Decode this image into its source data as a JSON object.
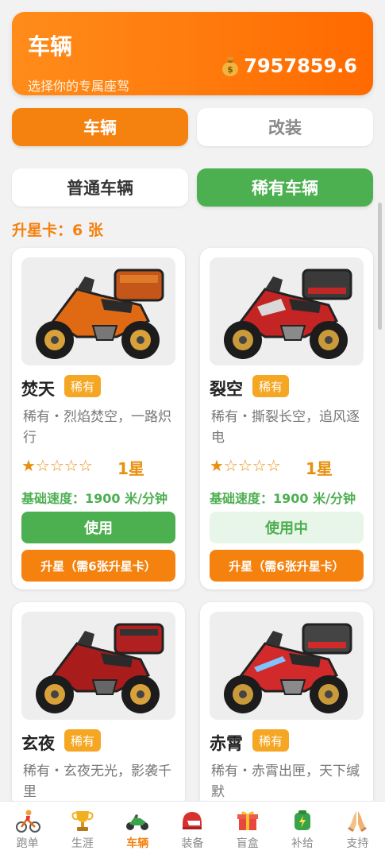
{
  "header": {
    "title": "车辆",
    "subtitle": "选择你的专属座驾",
    "coins": "7957859.6"
  },
  "tabs": {
    "vehicles": "车辆",
    "modify": "改装"
  },
  "subtabs": {
    "normal": "普通车辆",
    "rare": "稀有车辆"
  },
  "star_cards": "升星卡：6 张",
  "vehicles": [
    {
      "name": "焚天",
      "badge": "稀有",
      "desc": "稀有・烈焰焚空，一路炽行",
      "stars": "★☆☆☆☆",
      "level": "1星",
      "speed": "基础速度：1900 米/分钟",
      "use_label": "使用",
      "upgrade_label": "升星（需6张升星卡）"
    },
    {
      "name": "裂空",
      "badge": "稀有",
      "desc": "稀有・撕裂长空，追风逐电",
      "stars": "★☆☆☆☆",
      "level": "1星",
      "speed": "基础速度：1900 米/分钟",
      "use_label": "使用中",
      "upgrade_label": "升星（需6张升星卡）"
    },
    {
      "name": "玄夜",
      "badge": "稀有",
      "desc": "稀有・玄夜无光，影袭千里"
    },
    {
      "name": "赤霄",
      "badge": "稀有",
      "desc": "稀有・赤霄出匣，天下缄默"
    }
  ],
  "nav": [
    {
      "label": "跑单",
      "icon": "runner-bike-icon"
    },
    {
      "label": "生涯",
      "icon": "trophy-icon"
    },
    {
      "label": "车辆",
      "icon": "motorcycle-icon",
      "active": true
    },
    {
      "label": "装备",
      "icon": "helmet-icon"
    },
    {
      "label": "盲盒",
      "icon": "gift-box-icon"
    },
    {
      "label": "补给",
      "icon": "battery-pack-icon"
    },
    {
      "label": "支持",
      "icon": "pray-hands-icon"
    }
  ],
  "colors": {
    "accent": "#f5810f",
    "green": "#4caf50",
    "badge": "#f5a623"
  }
}
